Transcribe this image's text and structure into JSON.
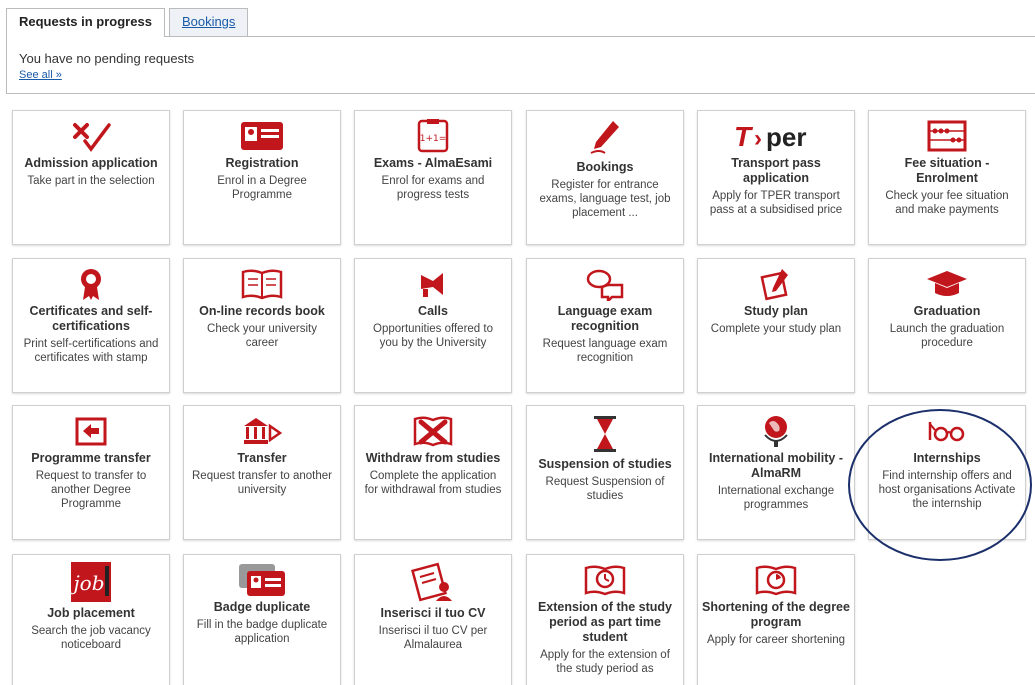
{
  "tabs": [
    {
      "label": "Requests in progress",
      "active": true
    },
    {
      "label": "Bookings",
      "active": false
    }
  ],
  "requests": {
    "message": "You have no pending requests",
    "see_all": "See all »"
  },
  "accent_color": "#c0161c",
  "tiles": [
    {
      "title": "Admission application",
      "desc": "Take part in the selection",
      "icon": "admission-icon"
    },
    {
      "title": "Registration",
      "desc": "Enrol in a Degree Programme",
      "icon": "id-card-icon"
    },
    {
      "title": "Exams - AlmaEsami",
      "desc": "Enrol for exams and progress tests",
      "icon": "exam-sheet-icon"
    },
    {
      "title": "Bookings",
      "desc": "Register for entrance exams, language test, job placement ...",
      "icon": "pencil-icon"
    },
    {
      "title": "Transport pass application",
      "desc": "Apply for TPER transport pass at a subsidised price",
      "icon": "tper-logo-icon",
      "logo_text": "T per"
    },
    {
      "title": "Fee situation - Enrolment",
      "desc": "Check your fee situation and make payments",
      "icon": "abacus-icon"
    },
    {
      "title": "Certificates and self-certifications",
      "desc": "Print self-certifications and certificates with stamp",
      "icon": "rosette-icon"
    },
    {
      "title": "On-line records book",
      "desc": "Check your university career",
      "icon": "book-icon"
    },
    {
      "title": "Calls",
      "desc": "Opportunities offered to you by the University",
      "icon": "megaphone-icon"
    },
    {
      "title": "Language exam recognition",
      "desc": "Request language exam recognition",
      "icon": "speech-bubbles-icon"
    },
    {
      "title": "Study plan",
      "desc": "Complete your study plan",
      "icon": "study-plan-icon"
    },
    {
      "title": "Graduation",
      "desc": "Launch the graduation procedure",
      "icon": "graduation-cap-icon"
    },
    {
      "title": "Programme transfer",
      "desc": "Request to transfer to another Degree Programme",
      "icon": "programme-transfer-icon"
    },
    {
      "title": "Transfer",
      "desc": "Request transfer to another university",
      "icon": "university-transfer-icon"
    },
    {
      "title": "Withdraw from studies",
      "desc": "Complete the application for withdrawal from studies",
      "icon": "withdraw-icon"
    },
    {
      "title": "Suspension of studies",
      "desc": "Request Suspension of studies",
      "icon": "hourglass-icon"
    },
    {
      "title": "International mobility - AlmaRM",
      "desc": "International exchange programmes",
      "icon": "globe-icon"
    },
    {
      "title": "Internships",
      "desc": "Find internship offers and host organisations Activate the internship",
      "icon": "glasses-icon"
    },
    {
      "title": "Job placement",
      "desc": "Search the job vacancy noticeboard",
      "icon": "job-logo-icon",
      "logo_text": "job"
    },
    {
      "title": "Badge duplicate",
      "desc": "Fill in the badge duplicate application",
      "icon": "badge-icon"
    },
    {
      "title": "Inserisci il tuo CV",
      "desc": "Inserisci il tuo CV per Almalaurea",
      "icon": "cv-icon"
    },
    {
      "title": "Extension of the study period as part time student",
      "desc": "Apply for the extension of the study period as",
      "icon": "clock-book-icon"
    },
    {
      "title": "Shortening of the degree program",
      "desc": "Apply for career shortening",
      "icon": "shortening-icon"
    }
  ]
}
